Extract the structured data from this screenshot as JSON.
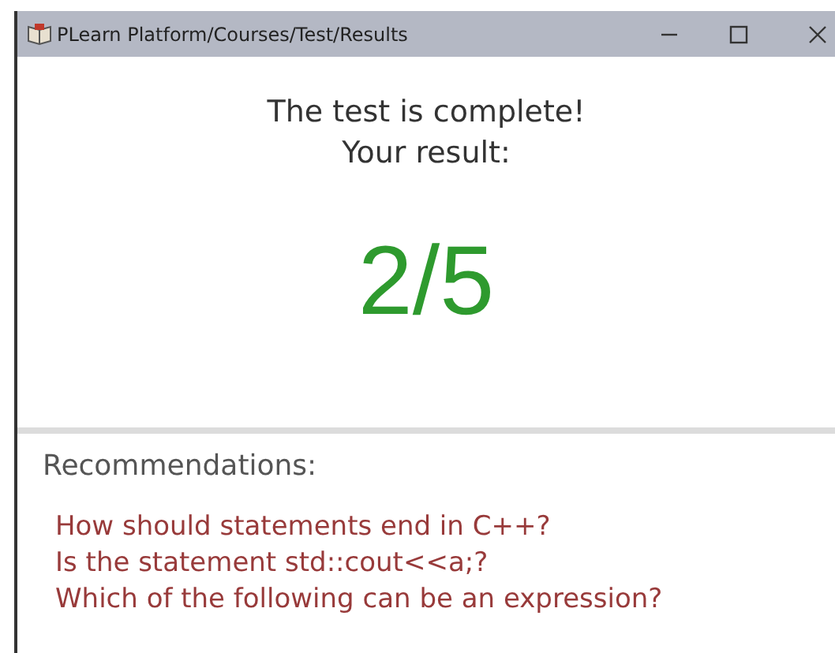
{
  "window": {
    "title": "PLearn Platform/Courses/Test/Results"
  },
  "result": {
    "heading": "The test is complete!",
    "subheading": "Your result:",
    "score": "2/5"
  },
  "recommendations": {
    "title": "Recommendations:",
    "items": [
      {
        "text": "How should statements end in C++?"
      },
      {
        "text": "Is the statement std::cout<<a;?"
      },
      {
        "text": "Which of the following can be an expression?"
      }
    ]
  }
}
